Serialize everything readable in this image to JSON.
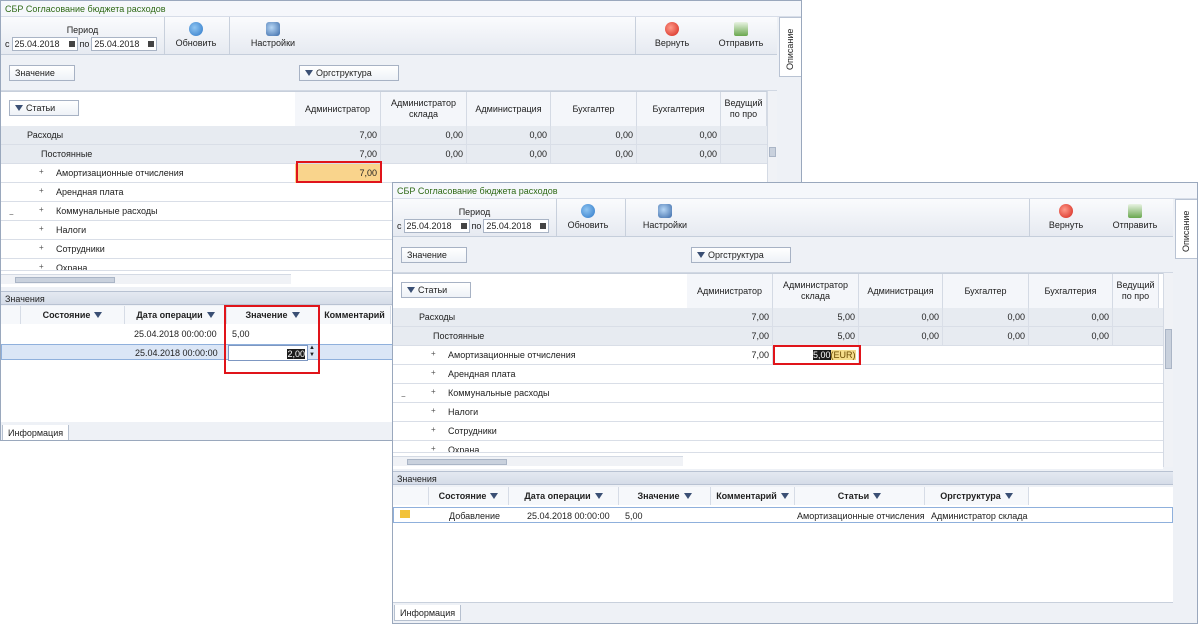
{
  "window_title": "СБР Согласование бюджета расходов",
  "side_tab": "Описание",
  "toolbar": {
    "period_label": "Период",
    "from_prefix": "с",
    "to_prefix": "по",
    "date_from": "25.04.2018",
    "date_to": "25.04.2018",
    "refresh_label": "Обновить",
    "settings_label": "Настройки",
    "return_label": "Вернуть",
    "send_label": "Отправить"
  },
  "filters": {
    "value_chip": "Значение",
    "org_chip": "Оргструктура",
    "articles_chip": "Статьи"
  },
  "pivot": {
    "columns": [
      "Администратор",
      "Администратор склада",
      "Администрация",
      "Бухгалтер",
      "Бухгалтерия",
      "Ведущий по про"
    ],
    "rows": {
      "expenses": "Расходы",
      "constant": "Постоянные",
      "items": [
        "Амортизационные отчисления",
        "Арендная плата",
        "Коммунальные расходы",
        "Налоги",
        "Сотрудники",
        "Охрана"
      ]
    },
    "win1": {
      "expenses_vals": [
        "7,00",
        "0,00",
        "0,00",
        "0,00",
        "0,00"
      ],
      "constant_vals": [
        "7,00",
        "0,00",
        "0,00",
        "0,00",
        "0,00"
      ],
      "amort_val": "7,00"
    },
    "win2": {
      "expenses_vals": [
        "7,00",
        "5,00",
        "0,00",
        "0,00",
        "0,00"
      ],
      "constant_vals": [
        "7,00",
        "5,00",
        "0,00",
        "0,00",
        "0,00"
      ],
      "amort_val": "7,00",
      "edit_val": "5,00",
      "edit_currency": "(EUR)"
    }
  },
  "values_panel": {
    "title": "Значения",
    "headers_win1": [
      "Состояние",
      "Дата операции",
      "Значение",
      "Комментарий"
    ],
    "rows_win1": [
      {
        "date": "25.04.2018 00:00:00",
        "value": "5,00"
      },
      {
        "date": "25.04.2018 00:00:00",
        "value": "2,00"
      }
    ],
    "headers_win2": [
      "Состояние",
      "Дата операции",
      "Значение",
      "Комментарий",
      "Статьи",
      "Оргструктура"
    ],
    "rows_win2": [
      {
        "state": "Добавление",
        "date": "25.04.2018 00:00:00",
        "value": "5,00",
        "comment": "",
        "article": "Амортизационные отчисления",
        "org": "Администратор склада"
      }
    ]
  },
  "info_tab": "Информация"
}
